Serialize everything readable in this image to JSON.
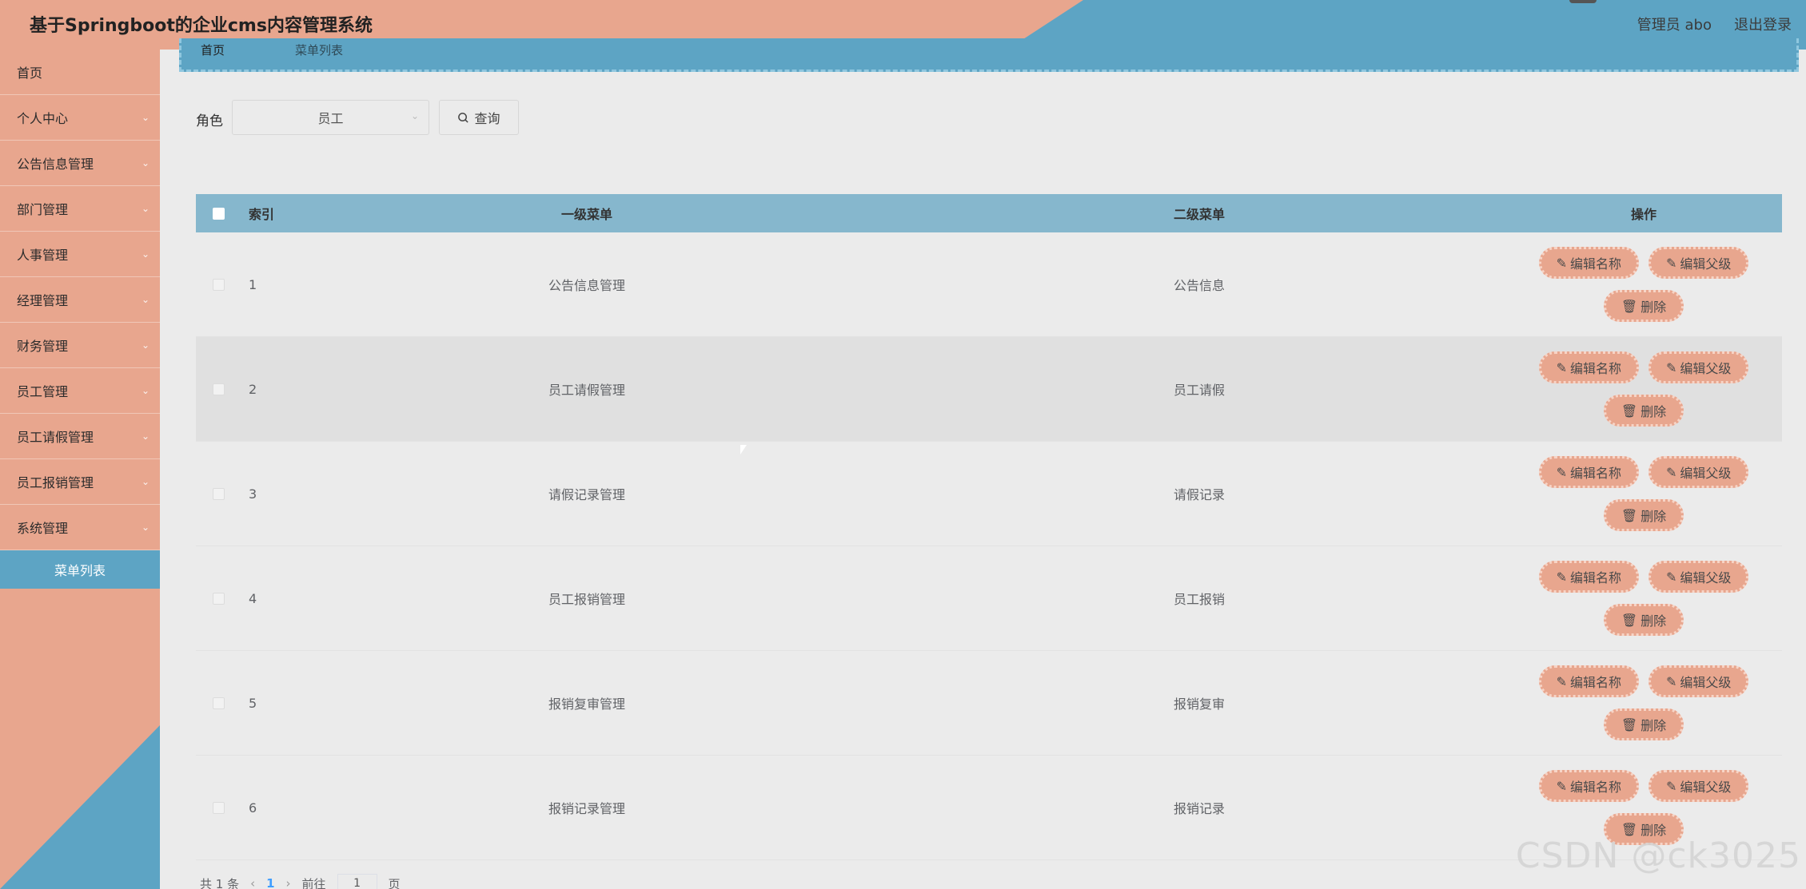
{
  "header": {
    "title": "基于Springboot的企业cms内容管理系统",
    "user": "管理员 abo",
    "logout": "退出登录"
  },
  "sidebar": {
    "items": [
      {
        "label": "首页",
        "has_chevron": false
      },
      {
        "label": "个人中心",
        "has_chevron": true
      },
      {
        "label": "公告信息管理",
        "has_chevron": true
      },
      {
        "label": "部门管理",
        "has_chevron": true
      },
      {
        "label": "人事管理",
        "has_chevron": true
      },
      {
        "label": "经理管理",
        "has_chevron": true
      },
      {
        "label": "财务管理",
        "has_chevron": true
      },
      {
        "label": "员工管理",
        "has_chevron": true
      },
      {
        "label": "员工请假管理",
        "has_chevron": true
      },
      {
        "label": "员工报销管理",
        "has_chevron": true
      },
      {
        "label": "系统管理",
        "has_chevron": true
      }
    ],
    "active_sub": "菜单列表"
  },
  "breadcrumb": {
    "home": "首页",
    "current": "菜单列表"
  },
  "search": {
    "role_label": "角色",
    "role_value": "员工",
    "query_button": "查询"
  },
  "table": {
    "columns": [
      "索引",
      "一级菜单",
      "二级菜单",
      "操作"
    ],
    "rows": [
      {
        "index": "1",
        "menu1": "公告信息管理",
        "menu2": "公告信息"
      },
      {
        "index": "2",
        "menu1": "员工请假管理",
        "menu2": "员工请假"
      },
      {
        "index": "3",
        "menu1": "请假记录管理",
        "menu2": "请假记录"
      },
      {
        "index": "4",
        "menu1": "员工报销管理",
        "menu2": "员工报销"
      },
      {
        "index": "5",
        "menu1": "报销复审管理",
        "menu2": "报销复审"
      },
      {
        "index": "6",
        "menu1": "报销记录管理",
        "menu2": "报销记录"
      }
    ],
    "actions": {
      "edit_name": "编辑名称",
      "edit_parent": "编辑父级",
      "delete": "删除"
    }
  },
  "pagination": {
    "total": "共 1 条",
    "current_page": "1",
    "goto_prefix": "前往",
    "goto_value": "1",
    "goto_suffix": "页"
  },
  "watermark": "CSDN @ck3025",
  "colors": {
    "peach": "#e8a68e",
    "blue": "#5da4c4",
    "table_header": "#86b7cd",
    "background": "#ebebeb"
  }
}
